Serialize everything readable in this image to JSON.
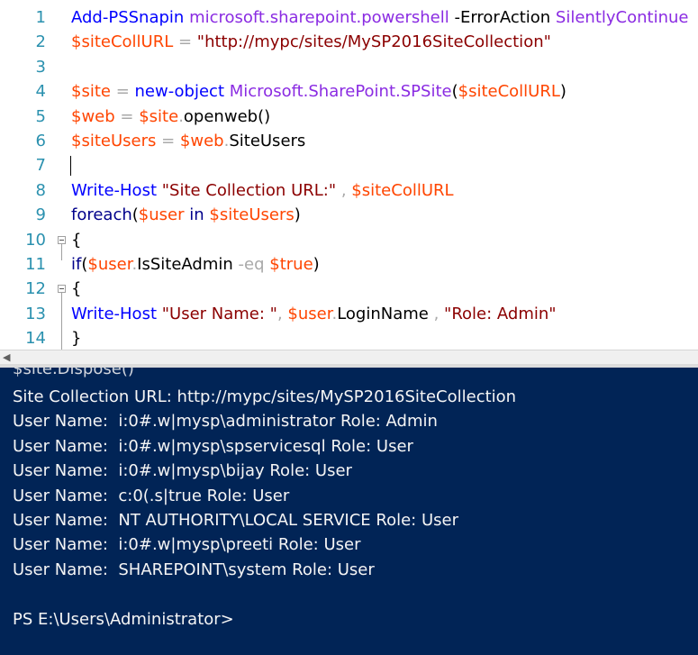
{
  "editor": {
    "line_numbers": [
      "1",
      "2",
      "3",
      "4",
      "5",
      "6",
      "7",
      "8",
      "9",
      "10",
      "11",
      "12",
      "13",
      "14"
    ],
    "lines": [
      [
        {
          "t": "Add-PSSnapin",
          "c": "cmd"
        },
        {
          "t": " ",
          "c": "mem"
        },
        {
          "t": "microsoft.sharepoint.powershell",
          "c": "arg"
        },
        {
          "t": " -ErrorAction ",
          "c": "mem"
        },
        {
          "t": "SilentlyContinue",
          "c": "arg"
        }
      ],
      [
        {
          "t": "$siteCollURL",
          "c": "var"
        },
        {
          "t": " = ",
          "c": "op"
        },
        {
          "t": "\"http://mypc/sites/MySP2016SiteCollection\"",
          "c": "str"
        }
      ],
      [],
      [
        {
          "t": "$site",
          "c": "var"
        },
        {
          "t": " = ",
          "c": "op"
        },
        {
          "t": "new-object",
          "c": "cmd"
        },
        {
          "t": " ",
          "c": "mem"
        },
        {
          "t": "Microsoft.SharePoint.SPSite",
          "c": "arg"
        },
        {
          "t": "(",
          "c": "paren"
        },
        {
          "t": "$siteCollURL",
          "c": "var"
        },
        {
          "t": ")",
          "c": "paren"
        }
      ],
      [
        {
          "t": "$web",
          "c": "var"
        },
        {
          "t": " = ",
          "c": "op"
        },
        {
          "t": "$site",
          "c": "var"
        },
        {
          "t": ".",
          "c": "op"
        },
        {
          "t": "openweb()",
          "c": "mem"
        }
      ],
      [
        {
          "t": "$siteUsers",
          "c": "var"
        },
        {
          "t": " = ",
          "c": "op"
        },
        {
          "t": "$web",
          "c": "var"
        },
        {
          "t": ".",
          "c": "op"
        },
        {
          "t": "SiteUsers",
          "c": "mem"
        }
      ],
      [],
      [
        {
          "t": "Write-Host",
          "c": "cmd"
        },
        {
          "t": " ",
          "c": "mem"
        },
        {
          "t": "\"Site Collection URL:\"",
          "c": "str"
        },
        {
          "t": " , ",
          "c": "op"
        },
        {
          "t": "$siteCollURL",
          "c": "var"
        }
      ],
      [
        {
          "t": "foreach",
          "c": "kw"
        },
        {
          "t": "(",
          "c": "paren"
        },
        {
          "t": "$user",
          "c": "var"
        },
        {
          "t": " in ",
          "c": "kw"
        },
        {
          "t": "$siteUsers",
          "c": "var"
        },
        {
          "t": ")",
          "c": "paren"
        }
      ],
      [
        {
          "t": "{",
          "c": "mem"
        }
      ],
      [
        {
          "t": "if",
          "c": "kw"
        },
        {
          "t": "(",
          "c": "paren"
        },
        {
          "t": "$user",
          "c": "var"
        },
        {
          "t": ".",
          "c": "op"
        },
        {
          "t": "IsSiteAdmin",
          "c": "mem"
        },
        {
          "t": " -eq ",
          "c": "op"
        },
        {
          "t": "$true",
          "c": "var"
        },
        {
          "t": ")",
          "c": "paren"
        }
      ],
      [
        {
          "t": "{",
          "c": "mem"
        }
      ],
      [
        {
          "t": "Write-Host",
          "c": "cmd"
        },
        {
          "t": " ",
          "c": "mem"
        },
        {
          "t": "\"User Name: \"",
          "c": "str"
        },
        {
          "t": ", ",
          "c": "op"
        },
        {
          "t": "$user",
          "c": "var"
        },
        {
          "t": ".",
          "c": "op"
        },
        {
          "t": "LoginName",
          "c": "mem"
        },
        {
          "t": " , ",
          "c": "op"
        },
        {
          "t": "\"Role: Admin\"",
          "c": "str"
        }
      ],
      [
        {
          "t": "}",
          "c": "mem"
        }
      ]
    ],
    "fold_lines": [
      10,
      12
    ],
    "caret_line": 7
  },
  "colors": {
    "console_bg": "#012456",
    "line_number": "#2b91af",
    "cmdlet": "#0000ff",
    "argument": "#8a2be2",
    "variable": "#ff4500",
    "string": "#8b0000"
  },
  "console": {
    "cut_line": "$site.Dispose()",
    "lines": [
      "Site Collection URL: http://mypc/sites/MySP2016SiteCollection",
      "User Name:  i:0#.w|mysp\\administrator Role: Admin",
      "User Name:  i:0#.w|mysp\\spservicesql Role: User",
      "User Name:  i:0#.w|mysp\\bijay Role: User",
      "User Name:  c:0(.s|true Role: User",
      "User Name:  NT AUTHORITY\\LOCAL SERVICE Role: User",
      "User Name:  i:0#.w|mysp\\preeti Role: User",
      "User Name:  SHAREPOINT\\system Role: User",
      "",
      "PS E:\\Users\\Administrator>"
    ]
  }
}
